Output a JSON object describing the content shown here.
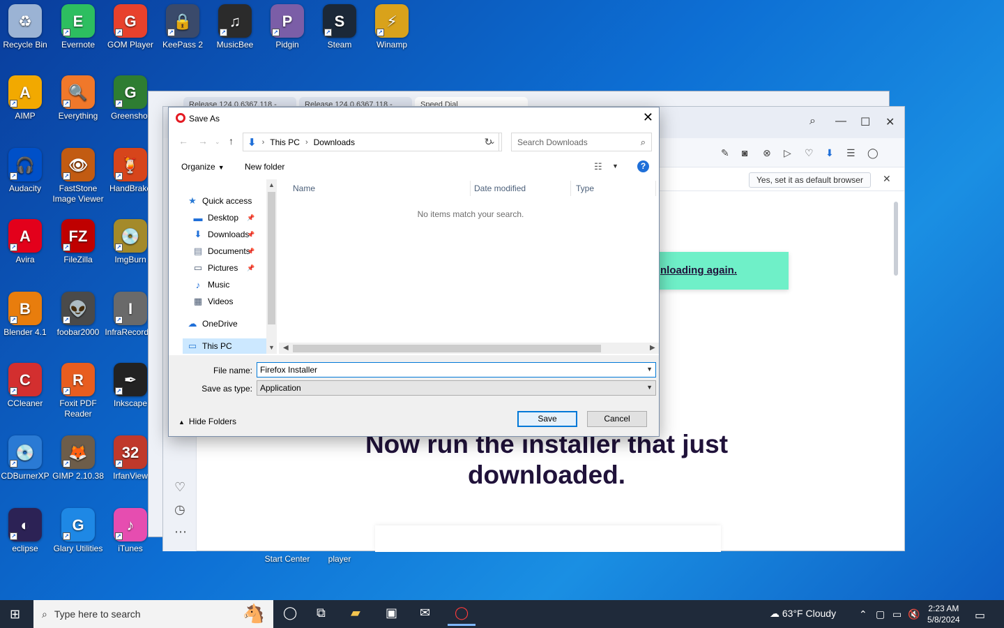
{
  "desktop": {
    "icons": [
      {
        "label": "Recycle Bin",
        "glyph": "♻",
        "color": "#9bb3d4"
      },
      {
        "label": "Evernote",
        "glyph": "E",
        "color": "#2dbe60"
      },
      {
        "label": "GOM Player",
        "glyph": "G",
        "color": "#e8412c"
      },
      {
        "label": "KeePass 2",
        "glyph": "🔒",
        "color": "#3a4a6b"
      },
      {
        "label": "MusicBee",
        "glyph": "♫",
        "color": "#2b2b2b"
      },
      {
        "label": "Pidgin",
        "glyph": "P",
        "color": "#7b5ea7"
      },
      {
        "label": "Steam",
        "glyph": "S",
        "color": "#1b2838"
      },
      {
        "label": "Winamp",
        "glyph": "⚡",
        "color": "#d9a21b"
      },
      {
        "label": "AIMP",
        "glyph": "A",
        "color": "#f2a900"
      },
      {
        "label": "Everything",
        "glyph": "🔍",
        "color": "#f0782a"
      },
      {
        "label": "Greenshot",
        "glyph": "G",
        "color": "#2e7d32"
      },
      {
        "label": "Audacity",
        "glyph": "🎧",
        "color": "#0050c8"
      },
      {
        "label": "FastStone Image Viewer",
        "glyph": "👁",
        "color": "#c25b12"
      },
      {
        "label": "HandBrake",
        "glyph": "🍹",
        "color": "#d7451b"
      },
      {
        "label": "Avira",
        "glyph": "A",
        "color": "#e3001b"
      },
      {
        "label": "FileZilla",
        "glyph": "FZ",
        "color": "#bf0000"
      },
      {
        "label": "ImgBurn",
        "glyph": "💿",
        "color": "#a48a2a"
      },
      {
        "label": "Blender 4.1",
        "glyph": "B",
        "color": "#e87d0d"
      },
      {
        "label": "foobar2000",
        "glyph": "👽",
        "color": "#4a4a4a"
      },
      {
        "label": "InfraRecorder",
        "glyph": "I",
        "color": "#6a6a6a"
      },
      {
        "label": "CCleaner",
        "glyph": "C",
        "color": "#d32f2f"
      },
      {
        "label": "Foxit PDF Reader",
        "glyph": "R",
        "color": "#e85d1f"
      },
      {
        "label": "Inkscape",
        "glyph": "✒",
        "color": "#222"
      },
      {
        "label": "CDBurnerXP",
        "glyph": "💿",
        "color": "#2a7ad4"
      },
      {
        "label": "GIMP 2.10.38",
        "glyph": "🦊",
        "color": "#6d5d4a"
      },
      {
        "label": "IrfanView",
        "glyph": "32",
        "color": "#c0392b"
      },
      {
        "label": "eclipse",
        "glyph": "◐",
        "color": "#2c2255"
      },
      {
        "label": "Glary Utilities",
        "glyph": "G",
        "color": "#1e88e5"
      },
      {
        "label": "iTunes",
        "glyph": "♪",
        "color": "#e64db0"
      }
    ],
    "partial_labels": [
      "Start Center",
      "player"
    ]
  },
  "browser_back": {
    "tabs": [
      "Release 124.0.6367.118 -",
      "Release 124.0.6367.118 -",
      "Speed Dial"
    ]
  },
  "browser": {
    "default_browser_button": "Yes, set it as default browser",
    "banner_text": "nloading again.",
    "headline": "Now run the installer that just downloaded."
  },
  "dialog": {
    "title": "Save As",
    "breadcrumb": [
      "This PC",
      "Downloads"
    ],
    "search_placeholder": "Search Downloads",
    "organize_label": "Organize",
    "new_folder_label": "New folder",
    "nav_items": [
      {
        "label": "Quick access",
        "icon": "star-icon",
        "glyph": "★",
        "color": "#2a7ad4",
        "pinned": false
      },
      {
        "label": "Desktop",
        "icon": "desktop-icon",
        "glyph": "▬",
        "color": "#1f6fd8",
        "pinned": true
      },
      {
        "label": "Downloads",
        "icon": "download-icon",
        "glyph": "⬇",
        "color": "#1f6fd8",
        "pinned": true
      },
      {
        "label": "Documents",
        "icon": "document-icon",
        "glyph": "▤",
        "color": "#6b7b94",
        "pinned": true
      },
      {
        "label": "Pictures",
        "icon": "pictures-icon",
        "glyph": "▭",
        "color": "#4a5a72",
        "pinned": true
      },
      {
        "label": "Music",
        "icon": "music-icon",
        "glyph": "♪",
        "color": "#1f6fd8",
        "pinned": false
      },
      {
        "label": "Videos",
        "icon": "video-icon",
        "glyph": "▦",
        "color": "#4a5a72",
        "pinned": false
      },
      {
        "label": "OneDrive",
        "icon": "cloud-icon",
        "glyph": "☁",
        "color": "#1f6fd8",
        "pinned": false
      },
      {
        "label": "This PC",
        "icon": "computer-icon",
        "glyph": "▭",
        "color": "#2a7ad4",
        "pinned": false
      }
    ],
    "columns": [
      "Name",
      "Date modified",
      "Type"
    ],
    "empty_message": "No items match your search.",
    "file_name_label": "File name:",
    "file_name_value": "Firefox Installer",
    "save_type_label": "Save as type:",
    "save_type_value": "Application",
    "hide_folders_label": "Hide Folders",
    "save_button": "Save",
    "cancel_button": "Cancel"
  },
  "taskbar": {
    "search_placeholder": "Type here to search",
    "weather": "63°F  Cloudy",
    "time": "2:23 AM",
    "date": "5/8/2024"
  }
}
